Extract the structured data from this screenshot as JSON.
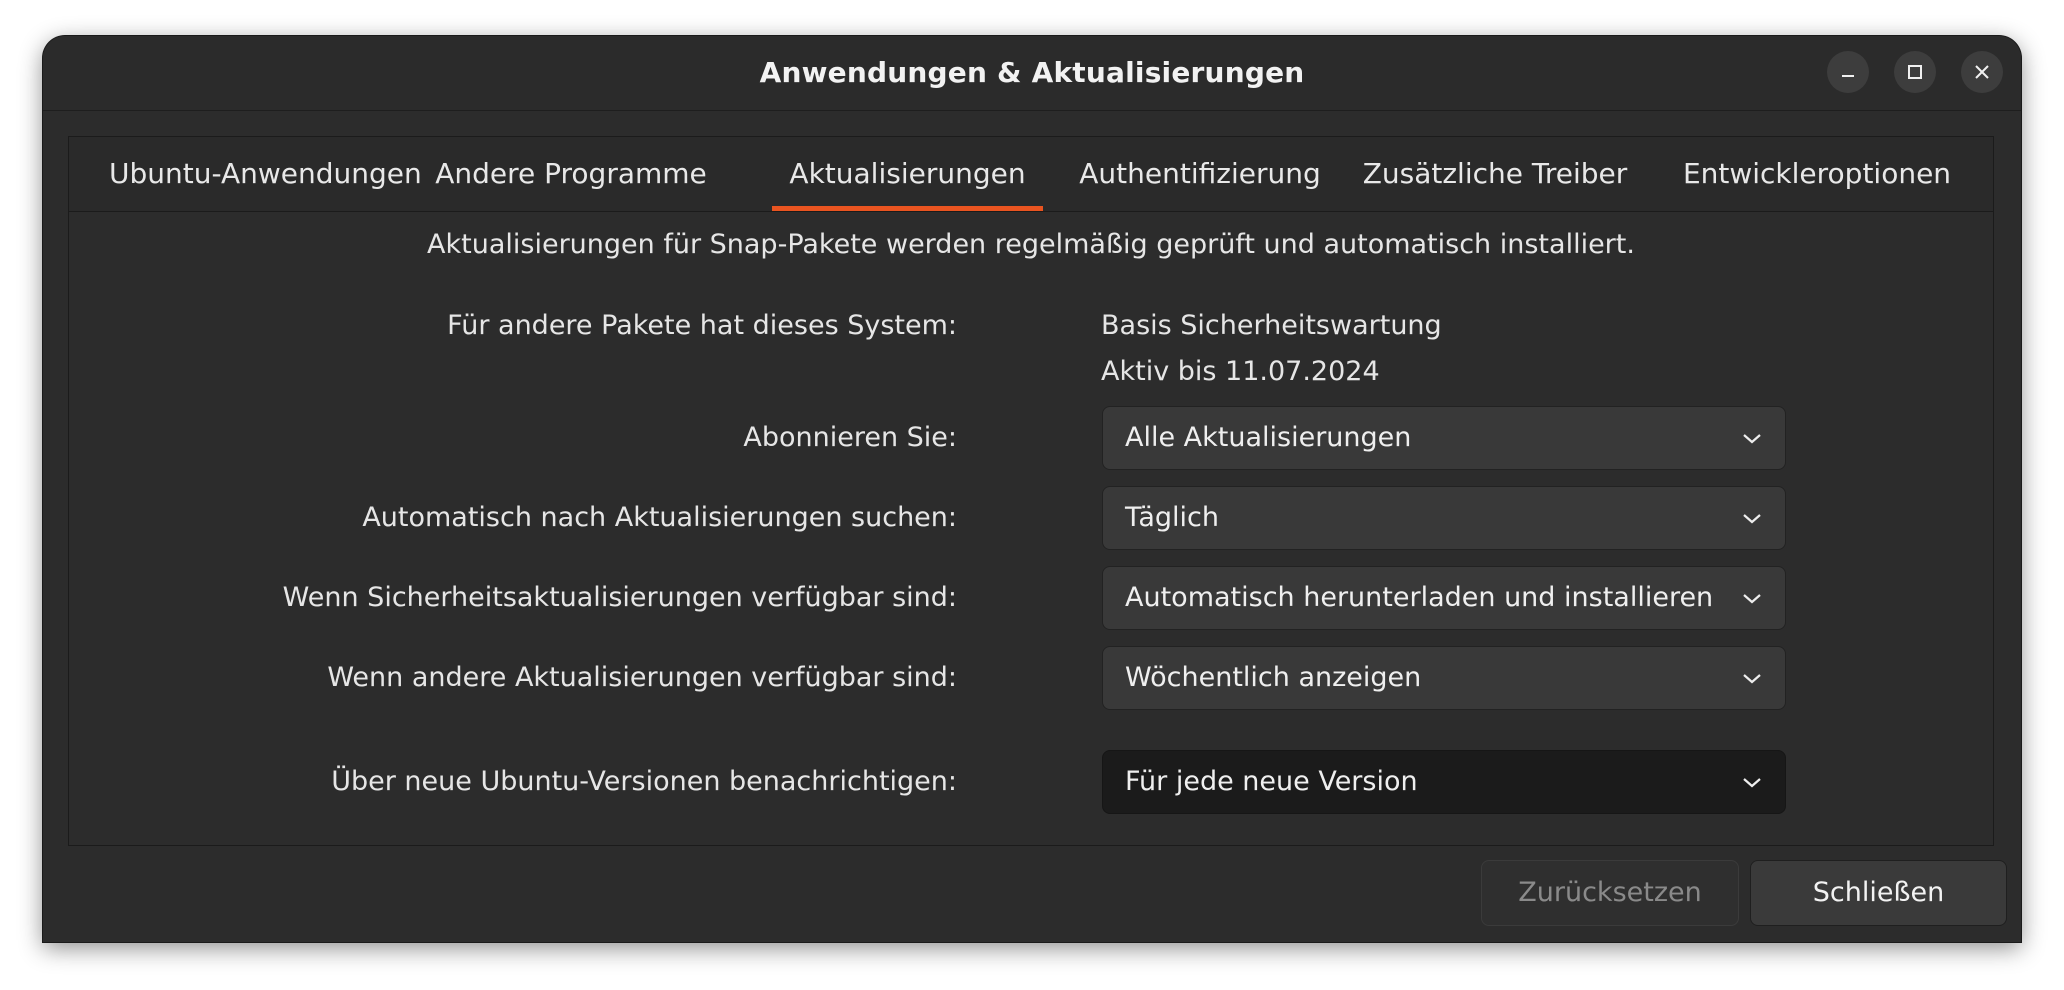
{
  "window": {
    "title": "Anwendungen & Aktualisierungen",
    "controls": [
      "minimize-icon",
      "maximize-icon",
      "close-icon"
    ]
  },
  "tabs": [
    {
      "label": "Ubuntu-Anwendungen",
      "active": false
    },
    {
      "label": "Andere Programme",
      "active": false
    },
    {
      "label": "Aktualisierungen",
      "active": true
    },
    {
      "label": "Authentifizierung",
      "active": false
    },
    {
      "label": "Zusätzliche Treiber",
      "active": false
    },
    {
      "label": "Entwickleroptionen",
      "active": false
    }
  ],
  "content": {
    "snap_info": "Aktualisierungen für Snap-Pakete werden regelmäßig geprüft und automatisch installiert.",
    "system_label": "Für andere Pakete hat dieses System:",
    "system_value": "Basis Sicherheitswartung",
    "system_value_2": "Aktiv bis 11.07.2024",
    "rows": [
      {
        "label": "Abonnieren Sie:",
        "value": "Alle Aktualisierungen"
      },
      {
        "label": "Automatisch nach Aktualisierungen suchen:",
        "value": "Täglich"
      },
      {
        "label": "Wenn Sicherheitsaktualisierungen verfügbar sind:",
        "value": "Automatisch herunterladen und installieren"
      },
      {
        "label": "Wenn andere Aktualisierungen verfügbar sind:",
        "value": "Wöchentlich anzeigen"
      },
      {
        "label": "Über neue Ubuntu-Versionen benachrichtigen:",
        "value": "Für jede neue Version"
      }
    ]
  },
  "footer": {
    "reset_label": "Zurücksetzen",
    "close_label": "Schließen"
  },
  "colors": {
    "accent": "#e95420",
    "background": "#2c2c2c"
  }
}
